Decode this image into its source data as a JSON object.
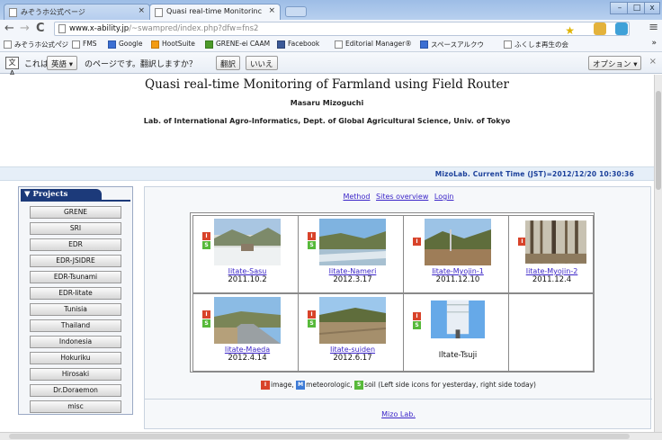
{
  "browser": {
    "tabs": [
      {
        "label": "みぞうホ公式ページ",
        "active": false
      },
      {
        "label": "Quasi real-time Monitorinc",
        "active": true
      }
    ],
    "url_host": "www.x-ability.jp",
    "url_path": "/~swampred/index.php?dfw=fns2",
    "window_controls": [
      "–",
      "□",
      "x"
    ]
  },
  "bookmarks": [
    {
      "label": "みぞうホ公式ぺ゚ジ",
      "icon": "page-icon"
    },
    {
      "label": "FMS",
      "icon": "page-icon"
    },
    {
      "label": "Google",
      "icon": "google-icon"
    },
    {
      "label": "HootSuite",
      "icon": "hootsuite-icon"
    },
    {
      "label": "GRENE-ei CAAM",
      "icon": "grene-icon"
    },
    {
      "label": "Facebook",
      "icon": "facebook-icon"
    },
    {
      "label": "Editorial Manager®",
      "icon": "editorial-icon"
    },
    {
      "label": "スペースアルクウ",
      "icon": "alc-icon"
    },
    {
      "label": "ふくしま再生の会",
      "icon": "page-icon"
    }
  ],
  "bookmarks_more": "»",
  "translate_bar": {
    "icon_text": "文A",
    "prefix": "これは",
    "language": "英語 ▾",
    "suffix": "のページです。翻訳しますか？",
    "translate_button": "翻訳",
    "no_button": "いいえ",
    "options_button": "オプション ▾"
  },
  "page": {
    "title": "Quasi real-time Monitoring of Farmland using Field Router",
    "author": "Masaru Mizoguchi",
    "lab": "Lab. of International Agro-Informatics, Dept. of Global Agricultural Science, Univ. of Tokyo",
    "current_time": "MizoLab. Current Time (JST)=2012/12/20 10:30:36"
  },
  "sidebar": {
    "heading": "▼ Projects",
    "items": [
      "GRENE",
      "SRI",
      "EDR",
      "EDR-JSIDRE",
      "EDR-Tsunami",
      "EDR-Iitate",
      "Tunisia",
      "Thailand",
      "Indonesia",
      "Hokuriku",
      "Hirosaki",
      "Dr.Doraemon",
      "misc"
    ]
  },
  "main": {
    "links": [
      "Method",
      "Sites overview",
      "Login"
    ],
    "sites": [
      {
        "name": "Iitate-Sasu",
        "date": "2011.10.2",
        "badges": [
          "I",
          "S"
        ],
        "scene": "snow"
      },
      {
        "name": "Iitate-Nameri",
        "date": "2012.3.17",
        "badges": [
          "I",
          "S"
        ],
        "scene": "river"
      },
      {
        "name": "Iitate-Myojin-1",
        "date": "2011.12.10",
        "badges": [
          "I"
        ],
        "scene": "field"
      },
      {
        "name": "Iitate-Myojin-2",
        "date": "2011.12.4",
        "badges": [
          "I"
        ],
        "scene": "forest"
      },
      {
        "name": "Iitate-Maeda",
        "date": "2012.4.14",
        "badges": [
          "I",
          "S"
        ],
        "scene": "road"
      },
      {
        "name": "Iitate-suiden",
        "date": "2012.6.17",
        "badges": [
          "I",
          "S"
        ],
        "scene": "paddy"
      },
      {
        "name": "",
        "date": "",
        "label": "Iltate-Tsuji",
        "badges": [
          "I",
          "S"
        ],
        "scene": "sky"
      }
    ],
    "legend": {
      "image": "image,",
      "met": "meteorologic,",
      "soil": "soil (Left side icons for yesterday, right side today)"
    },
    "footer_link": "Mizo Lab."
  }
}
